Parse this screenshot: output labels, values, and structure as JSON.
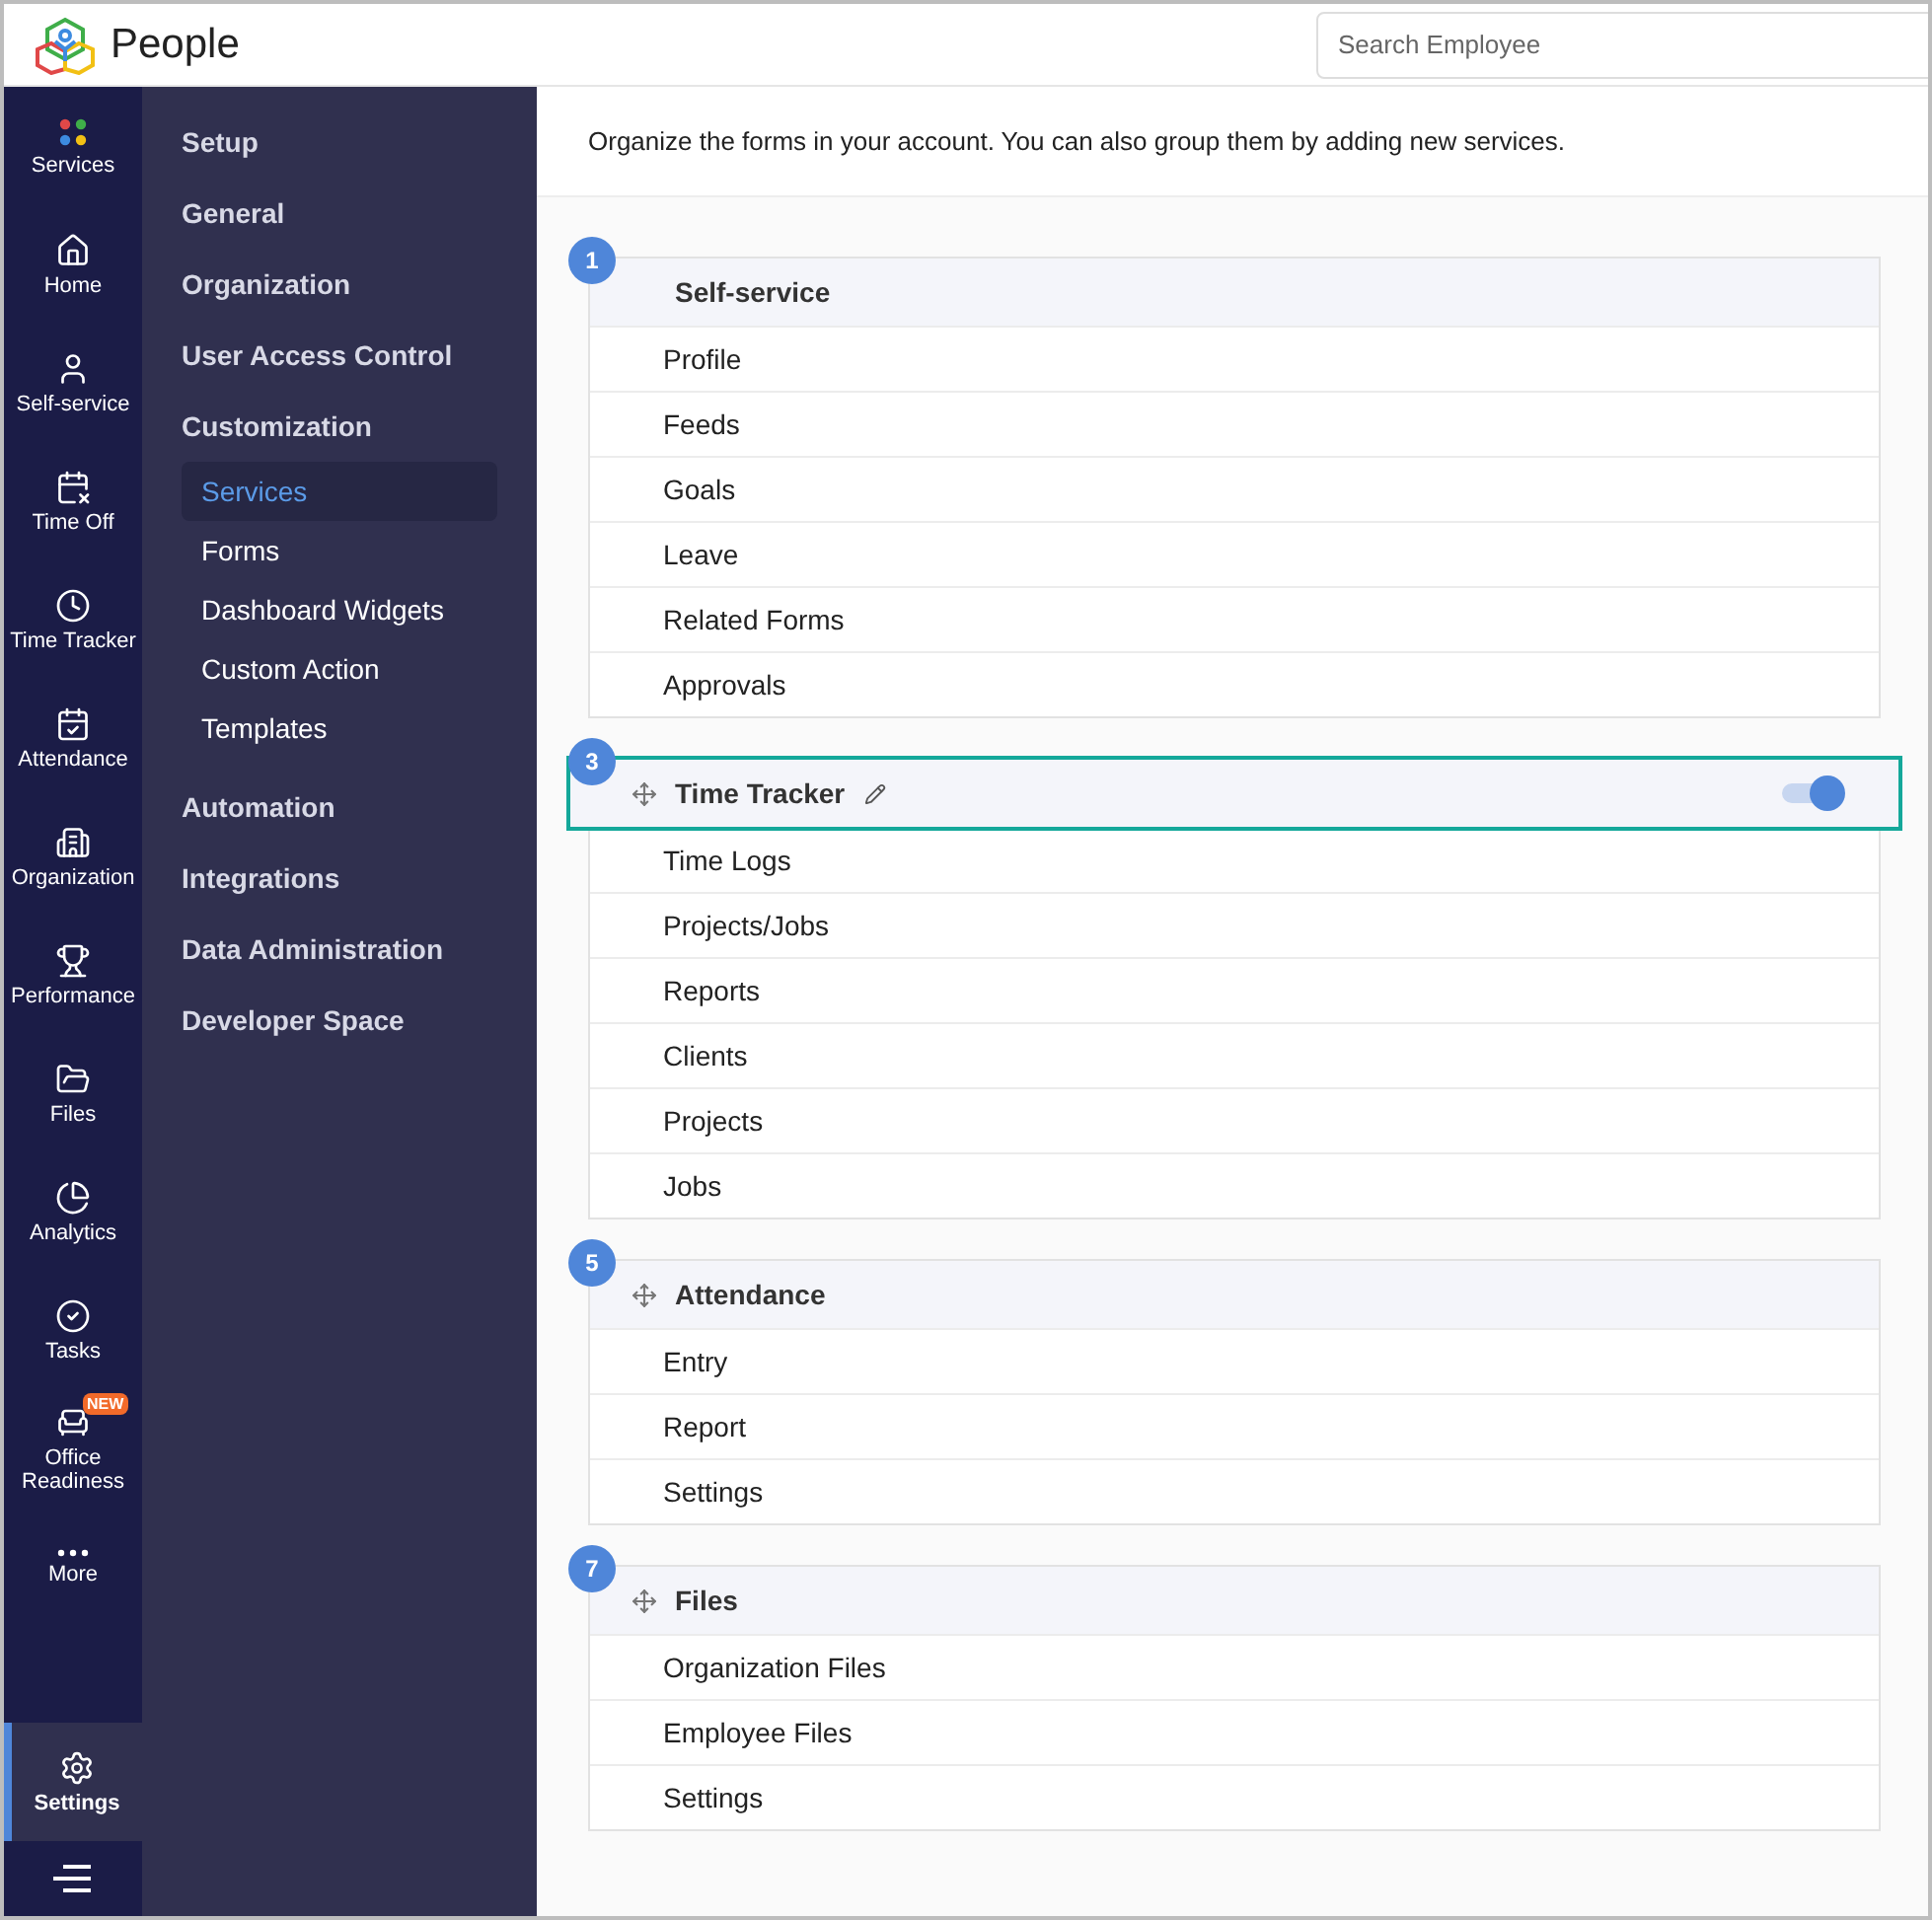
{
  "app": {
    "name": "People"
  },
  "search": {
    "placeholder": "Search Employee"
  },
  "rail": [
    {
      "kind": "services",
      "label": "Services",
      "selected": false
    },
    {
      "kind": "home",
      "label": "Home",
      "selected": false
    },
    {
      "kind": "user",
      "label": "Self-service",
      "selected": false
    },
    {
      "kind": "calendar",
      "label": "Time Off",
      "selected": false
    },
    {
      "kind": "clock",
      "label": "Time Tracker",
      "selected": false
    },
    {
      "kind": "calendar-check",
      "label": "Attendance",
      "selected": false
    },
    {
      "kind": "building",
      "label": "Organization",
      "selected": false
    },
    {
      "kind": "trophy",
      "label": "Performance",
      "selected": false
    },
    {
      "kind": "folder",
      "label": "Files",
      "selected": false
    },
    {
      "kind": "pie",
      "label": "Analytics",
      "selected": false
    },
    {
      "kind": "check",
      "label": "Tasks",
      "selected": false
    },
    {
      "kind": "desk",
      "label": "Office Readiness",
      "selected": false,
      "badge": "NEW"
    },
    {
      "kind": "more",
      "label": "More",
      "selected": false
    },
    {
      "kind": "gear",
      "label": "Settings",
      "selected": true
    }
  ],
  "settings_menu": [
    {
      "label": "Setup"
    },
    {
      "label": "General"
    },
    {
      "label": "Organization"
    },
    {
      "label": "User Access Control"
    },
    {
      "label": "Customization",
      "children": [
        {
          "label": "Services",
          "selected": true
        },
        {
          "label": "Forms",
          "selected": false
        },
        {
          "label": "Dashboard Widgets",
          "selected": false
        },
        {
          "label": "Custom Action",
          "selected": false
        },
        {
          "label": "Templates",
          "selected": false
        }
      ]
    },
    {
      "label": "Automation"
    },
    {
      "label": "Integrations"
    },
    {
      "label": "Data Administration"
    },
    {
      "label": "Developer Space"
    }
  ],
  "intro": "Organize the forms in your account. You can also group them by adding new services.",
  "services": [
    {
      "number": "1",
      "title": "Self-service",
      "draggable": false,
      "editable": false,
      "highlighted": false,
      "items": [
        "Profile",
        "Feeds",
        "Goals",
        "Leave",
        "Related Forms",
        "Approvals"
      ]
    },
    {
      "number": "3",
      "title": "Time Tracker",
      "draggable": true,
      "editable": true,
      "highlighted": true,
      "toggle": {
        "on": true
      },
      "items": [
        "Time Logs",
        "Projects/Jobs",
        "Reports",
        "Clients",
        "Projects",
        "Jobs"
      ]
    },
    {
      "number": "5",
      "title": "Attendance",
      "draggable": true,
      "editable": false,
      "highlighted": false,
      "items": [
        "Entry",
        "Report",
        "Settings"
      ]
    },
    {
      "number": "7",
      "title": "Files",
      "draggable": true,
      "editable": false,
      "highlighted": false,
      "items": [
        "Organization Files",
        "Employee Files",
        "Settings"
      ]
    }
  ]
}
